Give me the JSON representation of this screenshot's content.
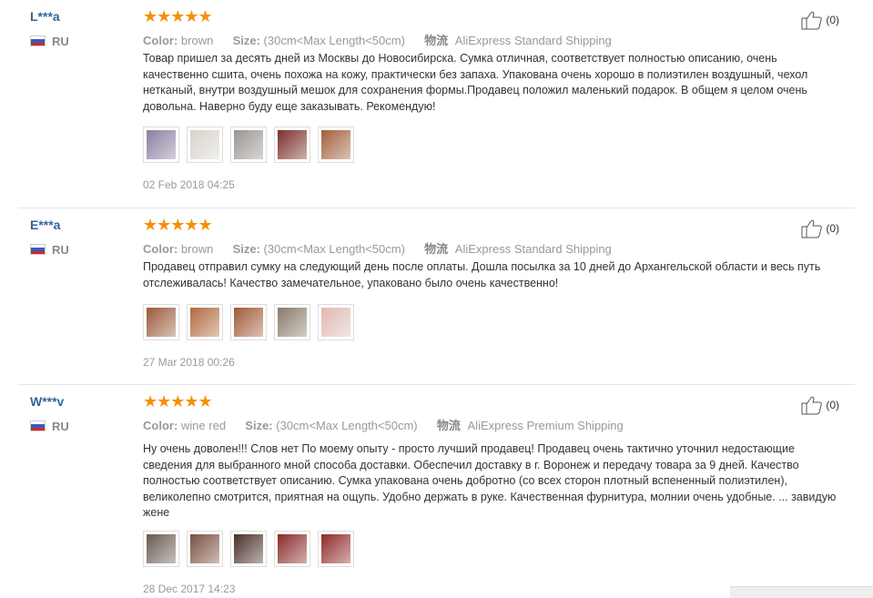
{
  "reviews": [
    {
      "user": "L***a",
      "country": "RU",
      "stars": "★★★★★",
      "likes": "(0)",
      "color_label": "Color:",
      "color_value": "brown",
      "size_label": "Size:",
      "size_value": "(30cm<Max Length<50cm)",
      "ship_icon": "物流",
      "shipping": "AliExpress Standard Shipping",
      "text": "Товар пришел за десять дней из Москвы до Новосибирска. Сумка отличная, соответствует полностью описанию, очень качественно сшита, очень похожа на кожу, практически без запаха. Упакована очень хорошо в полиэтилен воздушный, чехол нетканый, внутри воздушный мешок для сохранения формы.Продавец положил маленький подарок. В общем я целом очень довольна. Наверно буду еще заказывать. Рекомендую!",
      "photos": [
        "#8a7fa0",
        "#d8d3cb",
        "#9a9590",
        "#7a2f2a",
        "#a0603a"
      ],
      "date": "02 Feb 2018 04:25"
    },
    {
      "user": "E***a",
      "country": "RU",
      "stars": "★★★★★",
      "likes": "(0)",
      "color_label": "Color:",
      "color_value": "brown",
      "size_label": "Size:",
      "size_value": "(30cm<Max Length<50cm)",
      "ship_icon": "物流",
      "shipping": "AliExpress Standard Shipping",
      "text": "Продавец отправил сумку на следующий день после оплаты. Дошла посылка за 10 дней до Архангельской области и весь путь отслеживалась! Качество замечательное, упаковано было очень качественно!",
      "photos": [
        "#9a5a3a",
        "#b06a40",
        "#a05a38",
        "#8a7a6a",
        "#e0b8b0"
      ],
      "date": "27 Mar 2018 00:26"
    },
    {
      "user": "W***v",
      "country": "RU",
      "stars": "★★★★★",
      "likes": "(0)",
      "color_label": "Color:",
      "color_value": "wine red",
      "size_label": "Size:",
      "size_value": "(30cm<Max Length<50cm)",
      "ship_icon": "物流",
      "shipping": "AliExpress Premium Shipping",
      "text": "Ну очень доволен!!! Слов нет По моему опыту - просто лучший продавец! Продавец очень тактично уточнил недостающие сведения для выбранного мной способа доставки. Обеспечил доставку в г. Воронеж и передачу товара за 9 дней. Качество полностью соответствует описанию. Сумка упакована очень добротно (со всех сторон плотный вспененный полиэтилен), великолепно смотрится, приятная на ощупь. Удобно держать в руке. Качественная фурнитура, молнии очень удобные. ... завидую жене",
      "photos": [
        "#6a5a50",
        "#7a5040",
        "#4a3028",
        "#8a2a2a",
        "#902a28"
      ],
      "date": "28 Dec 2017 14:23"
    }
  ]
}
